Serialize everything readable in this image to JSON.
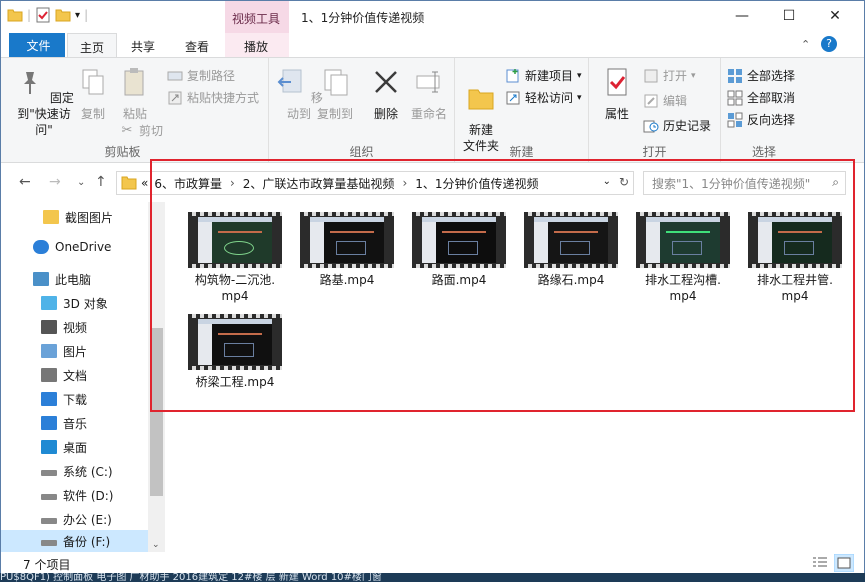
{
  "window": {
    "context_tab_group": "视频工具",
    "title": "1、1分钟价值传递视频",
    "minimize_label": "—",
    "maximize_label": "☐",
    "close_label": "✕"
  },
  "tabs": [
    "文件",
    "主页",
    "共享",
    "查看",
    "播放"
  ],
  "ribbon": {
    "clipboard": {
      "label": "剪贴板",
      "pin": "固定到\"快速访问\"",
      "copy": "复制",
      "paste": "粘贴",
      "copy_path": "复制路径",
      "paste_shortcut": "粘贴快捷方式",
      "cut": "剪切"
    },
    "organize": {
      "label": "组织",
      "move_to": "移动到",
      "copy_to": "复制到",
      "delete": "删除",
      "rename": "重命名"
    },
    "new": {
      "label": "新建",
      "new_folder": "新建\n文件夹",
      "new_item": "新建项目",
      "easy_access": "轻松访问"
    },
    "open": {
      "label": "打开",
      "properties": "属性",
      "open": "打开",
      "edit": "编辑",
      "history": "历史记录"
    },
    "select": {
      "label": "选择",
      "select_all": "全部选择",
      "select_none": "全部取消",
      "invert": "反向选择"
    }
  },
  "address": {
    "overflow": "«",
    "crumbs": [
      "6、市政算量",
      "2、广联达市政算量基础视频",
      "1、1分钟价值传递视频"
    ],
    "search_placeholder": "搜索\"1、1分钟价值传递视频\""
  },
  "sidebar": {
    "items": [
      {
        "label": "截图图片",
        "icon": "folder-icon"
      },
      {
        "label": "OneDrive",
        "icon": "cloud-icon"
      },
      {
        "label": "此电脑",
        "icon": "computer-icon"
      },
      {
        "label": "3D 对象",
        "icon": "cube-icon"
      },
      {
        "label": "视频",
        "icon": "video-icon"
      },
      {
        "label": "图片",
        "icon": "picture-icon"
      },
      {
        "label": "文档",
        "icon": "document-icon"
      },
      {
        "label": "下载",
        "icon": "download-icon"
      },
      {
        "label": "音乐",
        "icon": "music-icon"
      },
      {
        "label": "桌面",
        "icon": "desktop-icon"
      },
      {
        "label": "系统 (C:)",
        "icon": "drive-icon"
      },
      {
        "label": "软件 (D:)",
        "icon": "drive-icon"
      },
      {
        "label": "办公 (E:)",
        "icon": "drive-icon"
      },
      {
        "label": "备份 (F:)",
        "icon": "drive-icon"
      }
    ]
  },
  "files": [
    {
      "name": "构筑物-二沉池.\nmp4"
    },
    {
      "name": "路基.mp4"
    },
    {
      "name": "路面.mp4"
    },
    {
      "name": "路缘石.mp4"
    },
    {
      "name": "排水工程沟槽.\nmp4"
    },
    {
      "name": "排水工程井管.\nmp4"
    },
    {
      "name": "桥梁工程.mp4"
    }
  ],
  "status": {
    "count": "7 个项目"
  },
  "taskbar": {
    "text": "PU$8QF1)     控制面板     电子图     广材助手     2016建筑定     12#楼    层     新建 Word     10#楼门窗"
  }
}
